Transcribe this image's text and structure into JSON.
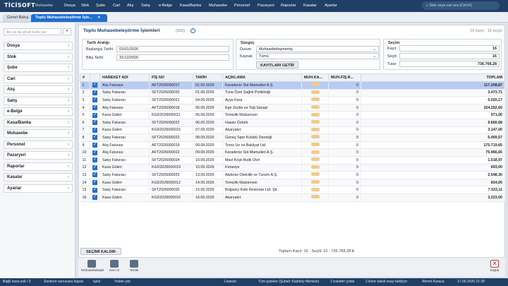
{
  "app": {
    "logo": "TİCİSOFT",
    "module": "Muhasebe",
    "search_placeholder": "Stok veya cari ara (Ctrl+K)"
  },
  "menu": [
    "Dosya",
    "Stok",
    "Şube",
    "Cari",
    "Alış",
    "Satış",
    "e-Belge",
    "Kasa/Banka",
    "Muhasebe",
    "Personel",
    "Pazaryeri",
    "Raporlar",
    "Kasalar",
    "Ayarlar"
  ],
  "tabs": {
    "home": "Genel Bakış",
    "active": "Toplu Muhasebeleştirme İşle...",
    "close": "✕"
  },
  "sidebar": {
    "filter_placeholder": "Ara ya da ekran kodu yaz",
    "items": [
      "Dosya",
      "Stok",
      "Şube",
      "Cari",
      "Alış",
      "Satış",
      "e-Belge",
      "Kasa/Banka",
      "Muhasebe",
      "Personel",
      "Pazaryeri",
      "Raporlar",
      "Kasalar",
      "Ayarlar"
    ]
  },
  "page": {
    "title": "Toplu Muhasebeleştirme İşlemleri",
    "count": "(932)",
    "right_info": "16 kayıt · 16 seçili"
  },
  "date": {
    "legend": "Tarih Aralığı",
    "start_label": "Başlangıç Tarihi",
    "start": "01/01/2026",
    "end_label": "Bitiş Tarihi",
    "end": "31/12/2026"
  },
  "filter": {
    "legend": "Süzgeç",
    "status_label": "Durum",
    "status": "Muhasebeleşmemiş",
    "source_label": "Kaynak",
    "source": "Tümü",
    "fetch_btn": "KAYITLARI GETİR"
  },
  "selection": {
    "legend": "Seçim",
    "rec_label": "Kayıt",
    "rec": "16",
    "sel_label": "Seçili",
    "sel": "16",
    "total_label": "Tutar",
    "total": "736.768,28"
  },
  "columns": [
    "#",
    "",
    "HAREKET ADI",
    "FİŞ NO",
    "TARİH",
    "AÇIKLAMA",
    "MUH.KA...",
    "MUH.FİŞ.R...",
    "TOPLAM"
  ],
  "rows": [
    [
      "1",
      "Alış Faturası",
      "AFT2026000017",
      "01.09.2026",
      "Karadeniz Süt Mamulleri A.Ş.",
      "0",
      "117.298,87"
    ],
    [
      "2",
      "Satış Faturası",
      "SFT2026000020",
      "01.09.2026",
      "Tuna Özel Sağlık Polikliniği",
      "0",
      "3.473,71"
    ],
    [
      "3",
      "Satış Faturası",
      "SFT2026000021",
      "04.09.2026",
      "Ayşe Kara",
      "0",
      "5.020,17"
    ],
    [
      "4",
      "Alış Faturası",
      "AFT2026000018",
      "05.09.2026",
      "Ege Zeytin ve Yağ Sanayi",
      "0",
      "324.252,60"
    ],
    [
      "5",
      "Kasa Gideri",
      "KGD2026000011",
      "05.09.2026",
      "Temizlik Malzemesi",
      "0",
      "971,00"
    ],
    [
      "6",
      "Satış Faturası",
      "SFT2026000022",
      "06.09.2026",
      "Hasan Öztürk",
      "0",
      "9.666,68"
    ],
    [
      "7",
      "Kasa Gideri",
      "KGD2026000015",
      "07.09.2026",
      "Akaryakıt",
      "0",
      "3.147,00"
    ],
    [
      "8",
      "Satış Faturası",
      "SFT2026000023",
      "08.09.2026",
      "Güneş Spor Kulübü Derneği",
      "0",
      "5.409,57"
    ],
    [
      "9",
      "Alış Faturası",
      "AFT2026000019",
      "09.09.2026",
      "Toros Un ve Bakliyat Ltd.",
      "0",
      "175.719,65"
    ],
    [
      "10",
      "Alış Faturası",
      "AFT2026000022",
      "09.09.2026",
      "Karadeniz Süt Mamulleri A.Ş.",
      "0",
      "75.966,65"
    ],
    [
      "11",
      "Satış Faturası",
      "SFT2026000024",
      "10.09.2026",
      "Mavi Köşk Butik Otel",
      "0",
      "1.518,97"
    ],
    [
      "12",
      "Kasa Gideri",
      "KGD2026000019",
      "10.09.2026",
      "Kırtasiye",
      "0",
      "693,00"
    ],
    [
      "13",
      "Satış Faturası",
      "SFT2026000025",
      "13.09.2026",
      "Akdeniz Otelcilik ve Turizm A.Ş.",
      "0",
      "2.048,30"
    ],
    [
      "14",
      "Kasa Gideri",
      "KGD2026000012",
      "14.09.2026",
      "Temizlik Malzemesi",
      "0",
      "834,00"
    ],
    [
      "15",
      "Satış Faturası",
      "SFT2026000026",
      "15.09.2026",
      "Boğaziçi Kafe Restoran Ltd. Şti.",
      "0",
      "7.533,11"
    ],
    [
      "16",
      "Kasa Gideri",
      "KGD2026000016",
      "16.09.2026",
      "Akaryakıt",
      "0",
      "3.223,00"
    ]
  ],
  "footer": {
    "clear_btn": "SEÇİMİ KALDIR",
    "summary": "Toplam Kayıt: 16 · Seçili: 16 · 736.768,28 ₺"
  },
  "toolbar": {
    "b1": "Muhasebeleştir",
    "b2": "Geri Al",
    "b3": "Yenile",
    "close": "Kapat"
  },
  "status": {
    "s1": "Bağlı kasa yok / 3",
    "s2": "Senkron sunucusu kapalı",
    "s3": "Işıklı",
    "s4": "Yedek yok",
    "s5": "Lisanslı",
    "s6": "Tüm şubeler (Şubeli: Kadıköy Merkezi)",
    "s7": "1 transfer yolda",
    "s8": "2 ikinci taksit onay bekliyor",
    "s9": "Ahmet Karaca",
    "s10": "17.09.2026 21:28"
  },
  "colors": {
    "topbar": "#1f3f66",
    "accent": "#1f6fd1",
    "selected_row": "#b9cbf0"
  }
}
